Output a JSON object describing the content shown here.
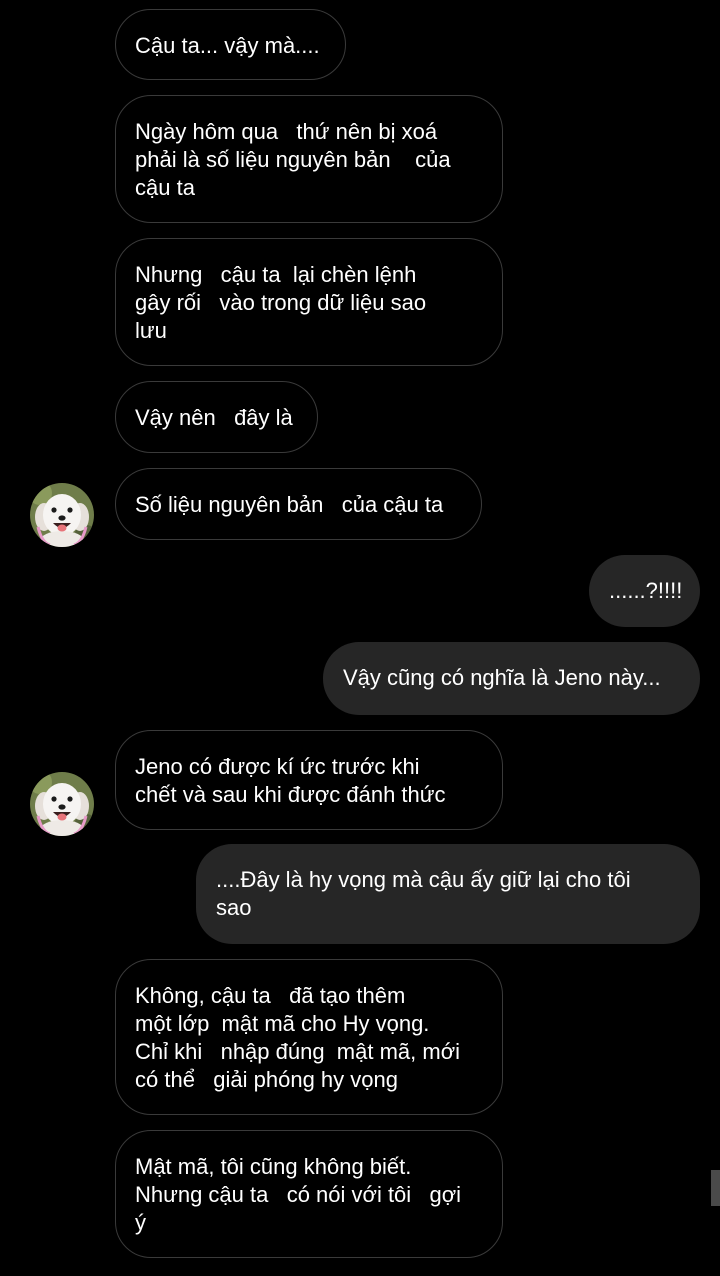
{
  "conversation": {
    "messages": [
      {
        "sender": "other",
        "text": "Cậu ta... vậy mà...."
      },
      {
        "sender": "other",
        "text": "Ngày hôm qua   thứ nên bị xoá\nphải là số liệu nguyên bản    của\ncậu ta"
      },
      {
        "sender": "other",
        "text": "Nhưng   cậu ta  lại chèn lệnh\ngây rối   vào trong dữ liệu sao\nlưu"
      },
      {
        "sender": "other",
        "text": "Vậy nên   đây là"
      },
      {
        "sender": "other",
        "text": "Số liệu nguyên bản   của cậu ta"
      },
      {
        "sender": "me",
        "text": "......?!!!!"
      },
      {
        "sender": "me",
        "text": "Vậy cũng có nghĩa là Jeno này..."
      },
      {
        "sender": "other",
        "text": "Jeno có được kí ức trước khi\nchết và sau khi được đánh thức"
      },
      {
        "sender": "me",
        "text": "....Đây là hy vọng mà cậu ấy giữ lại cho tôi\nsao"
      },
      {
        "sender": "other",
        "text": "Không, cậu ta   đã tạo thêm\nmột lớp  mật mã cho Hy vọng.\nChỉ khi   nhập đúng  mật mã, mới\ncó thể   giải phóng hy vọng"
      },
      {
        "sender": "other",
        "text": "Mật mã, tôi cũng không biết.\nNhưng cậu ta   có nói với tôi   gợi\ný"
      }
    ]
  },
  "avatar": {
    "icon": "dog-avatar-icon"
  },
  "colors": {
    "background": "#000000",
    "incoming_border": "#3a3a3a",
    "outgoing_bubble": "#262626",
    "text": "#ffffff"
  }
}
